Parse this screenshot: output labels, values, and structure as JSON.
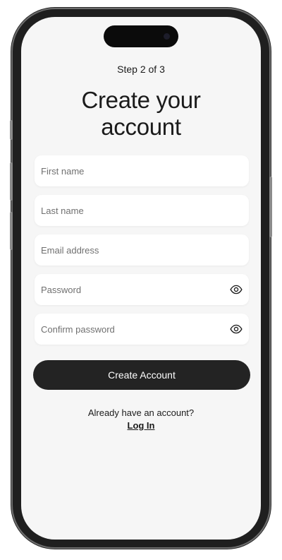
{
  "header": {
    "step": "Step 2 of 3",
    "title_line1": "Create your",
    "title_line2": "account"
  },
  "form": {
    "first_name": {
      "placeholder": "First name",
      "value": ""
    },
    "last_name": {
      "placeholder": "Last name",
      "value": ""
    },
    "email": {
      "placeholder": "Email address",
      "value": ""
    },
    "password": {
      "placeholder": "Password",
      "value": "",
      "icon": "eye-icon"
    },
    "confirm_password": {
      "placeholder": "Confirm password",
      "value": "",
      "icon": "eye-icon"
    }
  },
  "actions": {
    "create_label": "Create Account",
    "login_prompt": "Already have an account?",
    "login_label": "Log In"
  },
  "colors": {
    "screen_background": "#f6f6f6",
    "field_background": "#ffffff",
    "primary_button": "#232323",
    "text": "#1b1b1b",
    "placeholder": "#707070",
    "device_frame": "#1f1f1f"
  }
}
